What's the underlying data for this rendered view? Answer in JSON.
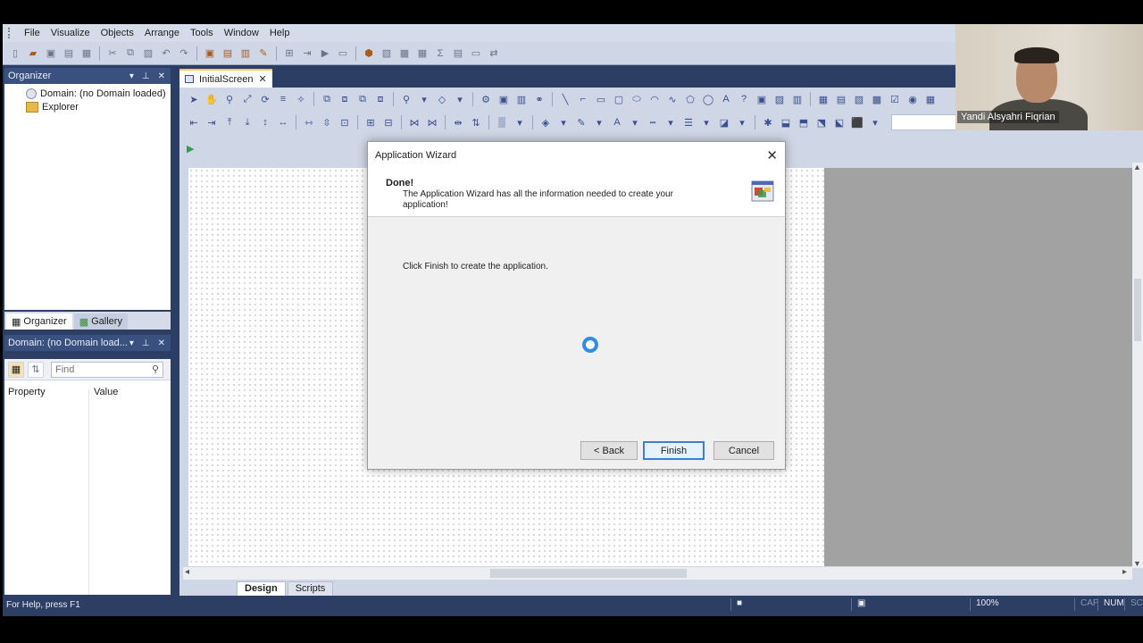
{
  "menu": [
    "File",
    "Visualize",
    "Objects",
    "Arrange",
    "Tools",
    "Window",
    "Help"
  ],
  "organizer": {
    "title": "Organizer",
    "tree": [
      {
        "label": "Domain: (no Domain loaded)"
      },
      {
        "label": "Explorer"
      }
    ],
    "tabs": [
      "Organizer",
      "Gallery"
    ]
  },
  "properties": {
    "title": "Domain: (no Domain load...",
    "find_placeholder": "Find",
    "col_property": "Property",
    "col_value": "Value"
  },
  "document": {
    "tab_label": "InitialScreen",
    "view_tabs": [
      "Design",
      "Scripts"
    ]
  },
  "status": {
    "help": "For Help, press F1",
    "zoom": "100%",
    "cap": "CAP",
    "num": "NUM",
    "scrl": "SCRL"
  },
  "dialog": {
    "title": "Application Wizard",
    "header_title": "Done!",
    "header_desc": "The Application Wizard has all the information needed to create your application!",
    "body_text": "Click Finish to create the application.",
    "back_label": "< Back",
    "finish_label": "Finish",
    "cancel_label": "Cancel"
  },
  "webcam": {
    "name": "Yandi Alsyahri Fiqrian"
  },
  "colors": {
    "chrome": "#2c3e63",
    "toolbar": "#cfd6e5",
    "accent_tab": "#f2c75c",
    "dialog_primary": "#3c7fd1",
    "spinner": "#2f8ce8"
  }
}
